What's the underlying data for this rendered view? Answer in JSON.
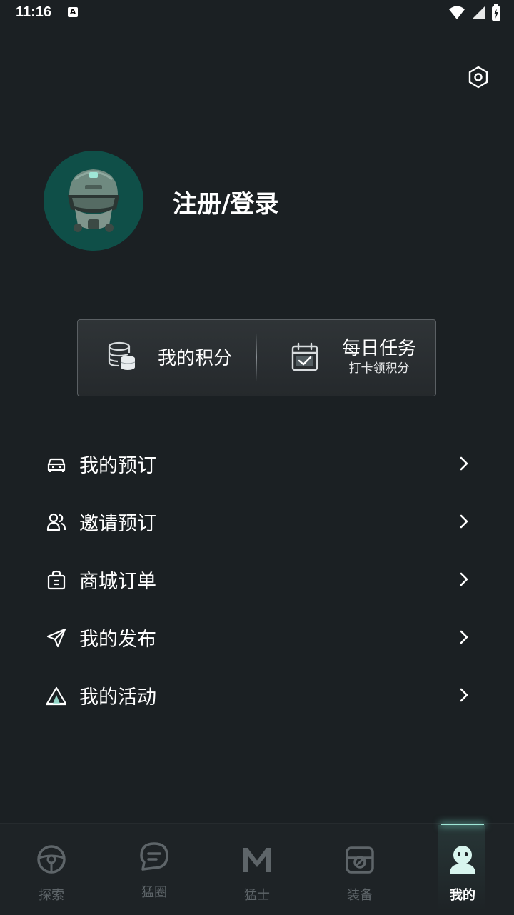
{
  "status_bar": {
    "time": "11:16",
    "notification_icon": "A"
  },
  "header": {
    "settings_icon": "hexagon-settings-icon"
  },
  "profile": {
    "login_label": "注册/登录"
  },
  "points_card": {
    "points_label": "我的积分",
    "tasks_title": "每日任务",
    "tasks_subtitle": "打卡领积分"
  },
  "menu": {
    "items": [
      {
        "label": "我的预订",
        "icon": "car-icon"
      },
      {
        "label": "邀请预订",
        "icon": "users-icon"
      },
      {
        "label": "商城订单",
        "icon": "shopping-bag-icon"
      },
      {
        "label": "我的发布",
        "icon": "send-icon"
      },
      {
        "label": "我的活动",
        "icon": "tent-icon"
      }
    ]
  },
  "bottom_nav": {
    "items": [
      {
        "label": "探索",
        "icon": "steering-wheel-icon"
      },
      {
        "label": "猛圈",
        "icon": "chat-bubble-icon"
      },
      {
        "label": "猛士",
        "icon": "brand-logo-icon"
      },
      {
        "label": "装备",
        "icon": "equipment-icon"
      },
      {
        "label": "我的",
        "icon": "profile-icon"
      }
    ],
    "active_index": 4
  },
  "colors": {
    "background": "#1b2023",
    "accent": "#9fe6d6",
    "avatar_bg": "#0f4f48",
    "inactive": "#5e6569"
  }
}
